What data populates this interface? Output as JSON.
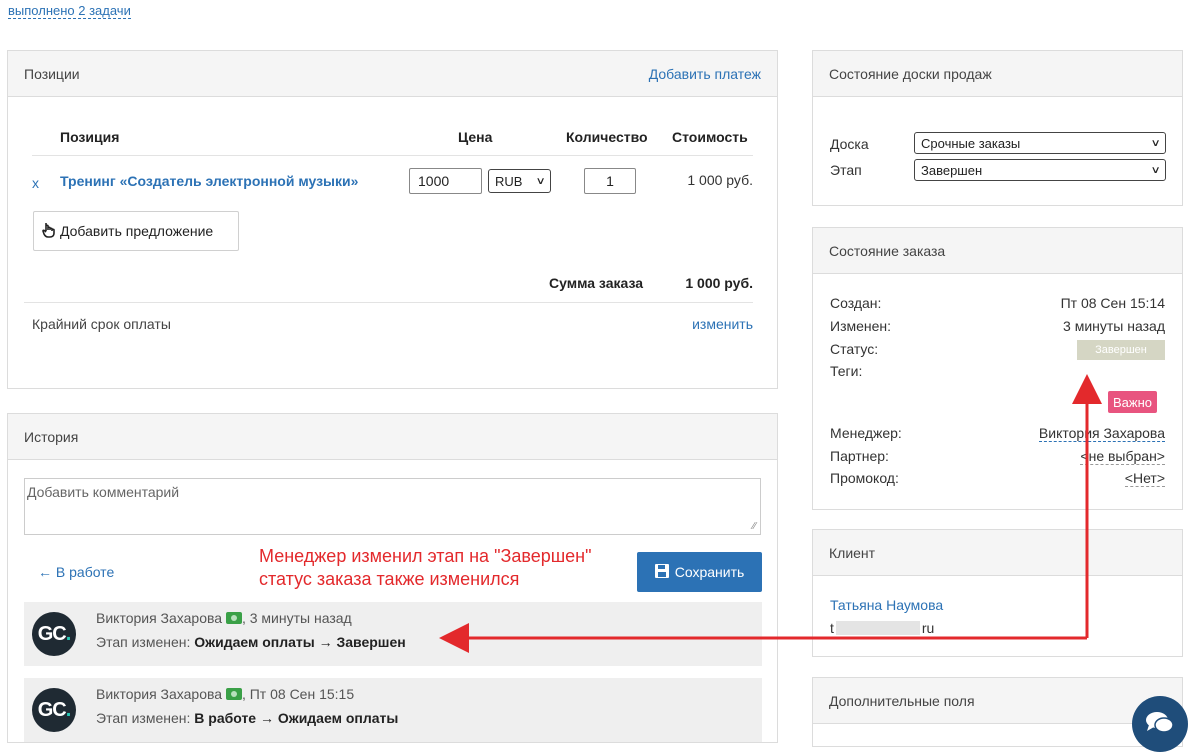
{
  "top_link": "выполнено 2 задачи",
  "positions": {
    "title": "Позиции",
    "add_payment": "Добавить платеж",
    "headers": {
      "position": "Позиция",
      "price": "Цена",
      "quantity": "Количество",
      "cost": "Стоимость"
    },
    "item": {
      "remove": "x",
      "name": "Тренинг «Создатель электронной музыки»",
      "price": "1000",
      "currency": "RUB",
      "quantity": "1",
      "cost": "1 000 руб."
    },
    "add_offer": "Добавить предложение",
    "total_label": "Сумма заказа",
    "total_value": "1 000 руб.",
    "deadline_label": "Крайний срок оплаты",
    "deadline_change": "изменить"
  },
  "history": {
    "title": "История",
    "comment_placeholder": "Добавить комментарий",
    "back_link": "← В работе",
    "save_label": "Сохранить",
    "items": [
      {
        "author": "Виктория Захарова",
        "time": ", 3 минуты назад",
        "prefix": "Этап изменен: ",
        "change": "Ожидаем оплаты → Завершен"
      },
      {
        "author": "Виктория Захарова",
        "time": ", Пт 08 Сен 15:15",
        "prefix": "Этап изменен: ",
        "change": "В работе → Ожидаем оплаты"
      }
    ],
    "avatar_text": "GC",
    "avatar_dot": "."
  },
  "annotation": {
    "line1": "Менеджер изменил этап на \"Завершен\"",
    "line2": "статус заказа также изменился",
    "color": "#e3292c"
  },
  "board": {
    "title": "Состояние доски продаж",
    "board_label": "Доска",
    "board_value": "Срочные заказы",
    "stage_label": "Этап",
    "stage_value": "Завершен"
  },
  "order": {
    "title": "Состояние заказа",
    "created_label": "Создан:",
    "created_value": "Пт 08 Сен 15:14",
    "modified_label": "Изменен:",
    "modified_value": "3 минуты назад",
    "status_label": "Статус:",
    "status_value": "Завершен",
    "tags_label": "Теги:",
    "tag_value": "Важно",
    "manager_label": "Менеджер:",
    "manager_value": "Виктория Захарова",
    "partner_label": "Партнер:",
    "partner_value": "<не выбран>",
    "promo_label": "Промокод:",
    "promo_value": "<Нет>"
  },
  "client": {
    "title": "Клиент",
    "name": "Татьяна Наумова",
    "email_start": "t",
    "email_end": "ru"
  },
  "extra": {
    "title": "Дополнительные поля"
  },
  "colors": {
    "accent": "#2c72b5",
    "tag": "#e8547f",
    "status": "#d5d6c4"
  }
}
